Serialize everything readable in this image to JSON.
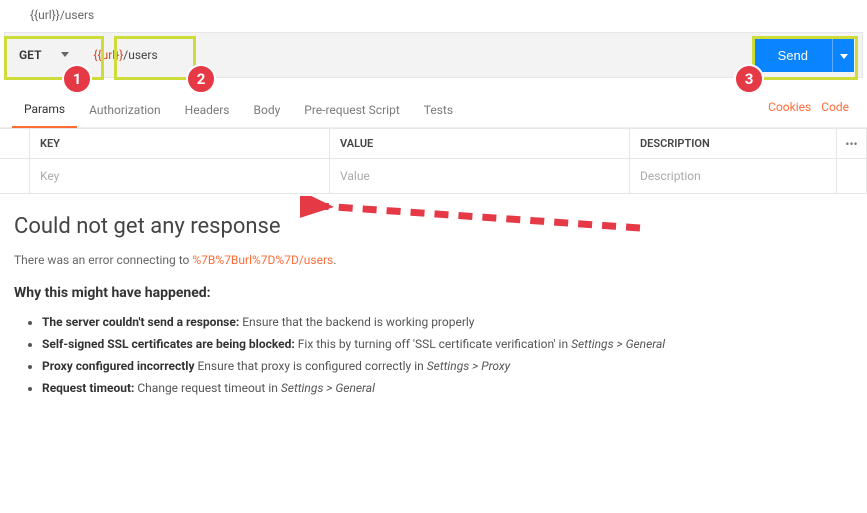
{
  "url_display": "{{url}}/users",
  "request": {
    "method": "GET",
    "url_var": "{{url}}",
    "url_rest": "/users",
    "send_label": "Send"
  },
  "tabs": {
    "params": "Params",
    "auth": "Authorization",
    "headers": "Headers",
    "body": "Body",
    "prerequest": "Pre-request Script",
    "tests": "Tests"
  },
  "right_links": {
    "cookies": "Cookies",
    "code": "Code"
  },
  "grid": {
    "head_key": "KEY",
    "head_value": "VALUE",
    "head_desc": "DESCRIPTION",
    "more_glyph": "•••",
    "ph_key": "Key",
    "ph_value": "Value",
    "ph_desc": "Description"
  },
  "error": {
    "title": "Could not get any response",
    "prefix": "There was an error connecting to ",
    "url": "%7B%7Burl%7D%7D/users",
    "dot": ".",
    "why": "Why this might have happened:",
    "r1b": "The server couldn't send a response:",
    "r1t": " Ensure that the backend is working properly",
    "r2b": "Self-signed SSL certificates are being blocked:",
    "r2t1": " Fix this by turning off 'SSL certificate verification' in ",
    "r2i": "Settings > General",
    "r3b": "Proxy configured incorrectly",
    "r3t1": " Ensure that proxy is configured correctly in ",
    "r3i": "Settings > Proxy",
    "r4b": "Request timeout:",
    "r4t1": " Change request timeout in ",
    "r4i": "Settings > General"
  },
  "annotations": {
    "a1": "1",
    "a2": "2",
    "a3": "3"
  }
}
